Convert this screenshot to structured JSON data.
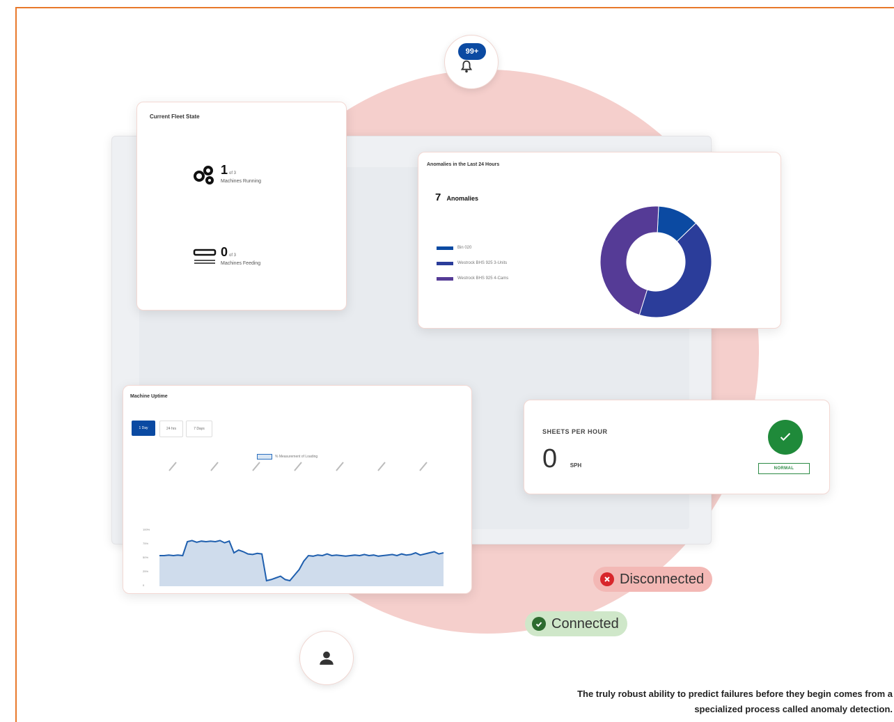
{
  "notifications": {
    "badge": "99+"
  },
  "fleet_card": {
    "title": "Current Fleet State",
    "running": {
      "count": "1",
      "of": "of 3",
      "label": "Machines Running"
    },
    "feeding": {
      "count": "0",
      "of": "of 3",
      "label": "Machines Feeding"
    }
  },
  "anomalies_card": {
    "title": "Anomalies in the Last 24 Hours",
    "count": "7",
    "count_label": "Anomalies",
    "legend": [
      {
        "label": "Bin 020",
        "color": "#0b4aa2"
      },
      {
        "label": "Westrock BHS 925 3-Units",
        "color": "#2b3d9a"
      },
      {
        "label": "Westrock BHS 925 4-Cams",
        "color": "#553b96"
      }
    ],
    "donut_fractions": [
      0.12,
      0.42,
      0.46
    ]
  },
  "uptime_card": {
    "title": "Machine Uptime",
    "tabs": [
      "1 Day",
      "24 hrs",
      "7 Days"
    ],
    "legend_label": "% Measurement of Loading",
    "y_ticks": [
      "100%",
      "75%",
      "50%",
      "25%",
      "0"
    ],
    "series": [
      55,
      55,
      56,
      55,
      56,
      55,
      80,
      82,
      79,
      81,
      80,
      81,
      80,
      82,
      78,
      81,
      60,
      65,
      62,
      58,
      57,
      59,
      58,
      10,
      12,
      15,
      18,
      12,
      10,
      20,
      30,
      45,
      55,
      54,
      56,
      55,
      58,
      55,
      56,
      55,
      54,
      55,
      56,
      55,
      57,
      55,
      56,
      54,
      55,
      56,
      57,
      55,
      58,
      56,
      57,
      60,
      56,
      58,
      60,
      62,
      58,
      60
    ]
  },
  "sph_card": {
    "label": "SHEETS PER HOUR",
    "value": "0",
    "unit": "SPH",
    "status": "NORMAL"
  },
  "status_pills": {
    "disconnected": "Disconnected",
    "connected": "Connected"
  },
  "caption": "The truly robust ability to predict failures before they begin comes from a specialized process called anomaly detection."
}
